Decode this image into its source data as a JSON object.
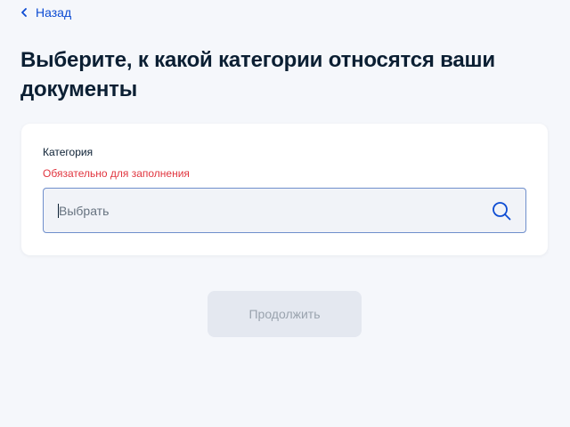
{
  "nav": {
    "back_label": "Назад"
  },
  "page": {
    "title": "Выберите, к какой категории относятся ваши документы"
  },
  "form": {
    "category_label": "Категория",
    "required_message": "Обязательно для заполнения",
    "select_placeholder": "Выбрать",
    "select_value": ""
  },
  "actions": {
    "continue_label": "Продолжить",
    "continue_enabled": false
  },
  "icons": {
    "back": "chevron-left-icon",
    "search": "search-icon"
  },
  "colors": {
    "background": "#f5f7fb",
    "link": "#0d4cd3",
    "error": "#e1353f",
    "input_border": "#6f8fcc",
    "button_disabled_bg": "#e4e8f0",
    "button_disabled_text": "#9aa3ae"
  }
}
